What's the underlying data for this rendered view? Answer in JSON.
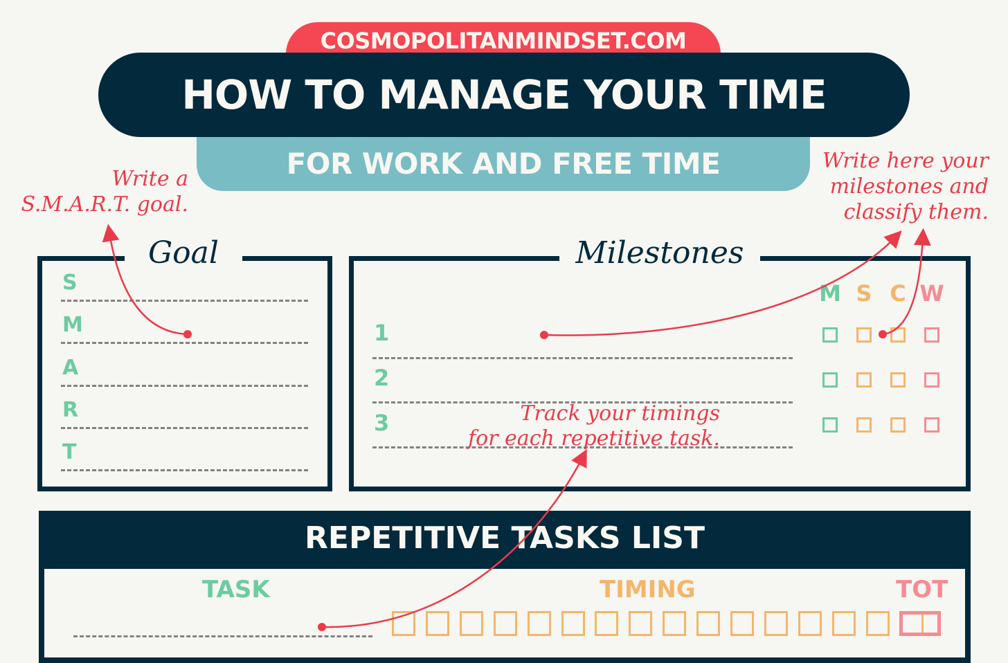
{
  "header": {
    "site": "COSMOPOLITANMINDSET.COM",
    "title": "HOW TO MANAGE YOUR TIME",
    "subtitle": "FOR WORK AND FREE TIME"
  },
  "colors": {
    "navy": "#03293c",
    "red": "#f54653",
    "teal": "#79bcc4",
    "green": "#6dcba0",
    "orange": "#f3b66a",
    "pink": "#f58c93",
    "annotation": "#ea3b4a"
  },
  "annotations": {
    "goal": [
      "Write a",
      "S.M.A.R.T. goal."
    ],
    "milestones": [
      "Write here your",
      "milestones and",
      "classify them."
    ],
    "timings": [
      "Track your timings",
      "for each repetitive task."
    ]
  },
  "goal": {
    "title": "Goal",
    "letters": [
      "S",
      "M",
      "A",
      "R",
      "T"
    ]
  },
  "milestones": {
    "title": "Milestones",
    "rows": [
      "1",
      "2",
      "3"
    ],
    "categories": [
      {
        "label": "M",
        "color": "#6dcba0"
      },
      {
        "label": "S",
        "color": "#f3b66a"
      },
      {
        "label": "C",
        "color": "#f3b66a"
      },
      {
        "label": "W",
        "color": "#f58c93"
      }
    ]
  },
  "repetitive_tasks": {
    "title": "REPETITIVE TASKS LIST",
    "columns": {
      "task": "TASK",
      "timing": "TIMING",
      "total": "TOT"
    },
    "timing_slots": 16
  }
}
